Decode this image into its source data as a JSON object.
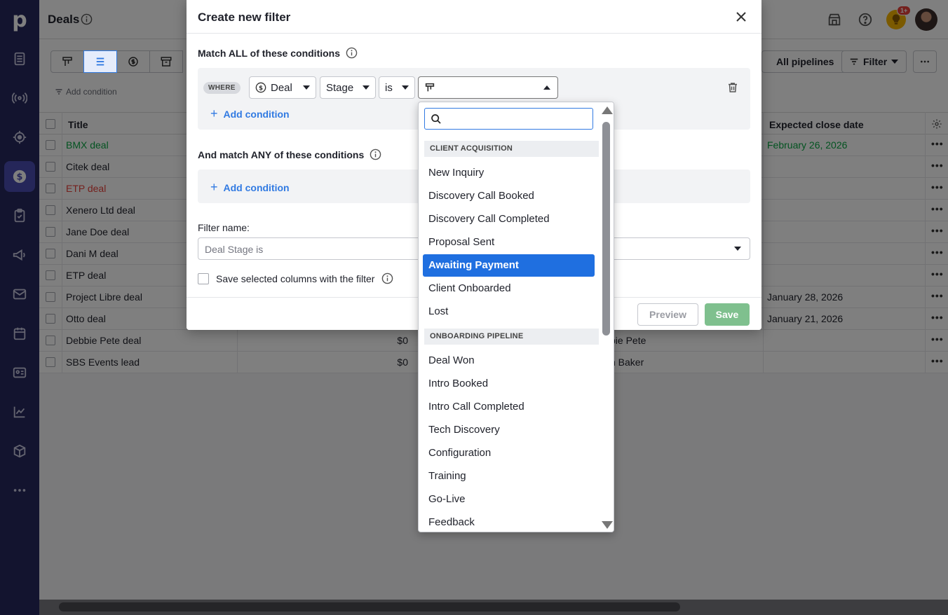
{
  "app": {
    "logo": "p",
    "page_title": "Deals",
    "notification_badge": "1+"
  },
  "toolbar": {
    "add_condition": "Add condition",
    "pipeline_select": "All pipelines",
    "filter_button": "Filter"
  },
  "table": {
    "columns": {
      "title": "Title",
      "expected_close": "Expected close date"
    },
    "rows": [
      {
        "title": "BMX deal",
        "value": "",
        "person": "",
        "date": "February 26, 2026",
        "color": "#08a742"
      },
      {
        "title": "Citek deal",
        "value": "",
        "person": "",
        "date": "",
        "color": ""
      },
      {
        "title": "ETP deal",
        "value": "",
        "person": "",
        "date": "",
        "color": "#e8403a"
      },
      {
        "title": "Xenero Ltd deal",
        "value": "",
        "person": "",
        "date": "",
        "color": ""
      },
      {
        "title": "Jane Doe deal",
        "value": "",
        "person": "",
        "date": "",
        "color": ""
      },
      {
        "title": "Dani M deal",
        "value": "",
        "person": "",
        "date": "",
        "color": ""
      },
      {
        "title": "ETP deal",
        "value": "",
        "person": "",
        "date": "",
        "color": ""
      },
      {
        "title": "Project Libre deal",
        "value": "",
        "person": "",
        "date": "January 28, 2026",
        "color": ""
      },
      {
        "title": "Otto deal",
        "value": "",
        "person": "",
        "date": "January 21, 2026",
        "color": ""
      },
      {
        "title": "Debbie Pete deal",
        "value": "$0",
        "person": "bie Pete",
        "date": "",
        "color": ""
      },
      {
        "title": "SBS Events lead",
        "value": "$0",
        "person": "n Baker",
        "date": "",
        "color": ""
      }
    ]
  },
  "modal": {
    "title": "Create new filter",
    "match_all_label": "Match ALL of these conditions",
    "where_tag": "WHERE",
    "condition": {
      "entity": "Deal",
      "field": "Stage",
      "operator": "is",
      "value": ""
    },
    "add_condition": "Add condition",
    "match_any_label": "And match ANY of these conditions",
    "filter_name_label": "Filter name:",
    "filter_name_value": "Deal Stage is",
    "save_columns_label": "Save selected columns with the filter",
    "preview_button": "Preview",
    "save_button": "Save"
  },
  "dropdown": {
    "search_placeholder": "",
    "groups": [
      {
        "name": "CLIENT ACQUISITION",
        "items": [
          "New Inquiry",
          "Discovery Call Booked",
          "Discovery Call Completed",
          "Proposal Sent",
          "Awaiting Payment",
          "Client Onboarded",
          "Lost"
        ]
      },
      {
        "name": "ONBOARDING PIPELINE",
        "items": [
          "Deal Won",
          "Intro Booked",
          "Intro Call Completed",
          "Tech Discovery",
          "Configuration",
          "Training",
          "Go-Live",
          "Feedback"
        ]
      }
    ],
    "selected": "Awaiting Payment"
  },
  "colors": {
    "nav_bg": "#26285e",
    "nav_active": "#4a4cb2",
    "accent_blue": "#317ae2",
    "selected_item": "#1f6fe0",
    "save_green": "#7fc08e"
  },
  "icons": {
    "nav": [
      "leads-icon",
      "activity-signal-icon",
      "target-icon",
      "deals-dollar-icon",
      "clipboard-icon",
      "megaphone-icon",
      "mail-icon",
      "calendar-icon",
      "contacts-card-icon",
      "chart-icon",
      "box-icon",
      "more-dots-icon"
    ]
  }
}
